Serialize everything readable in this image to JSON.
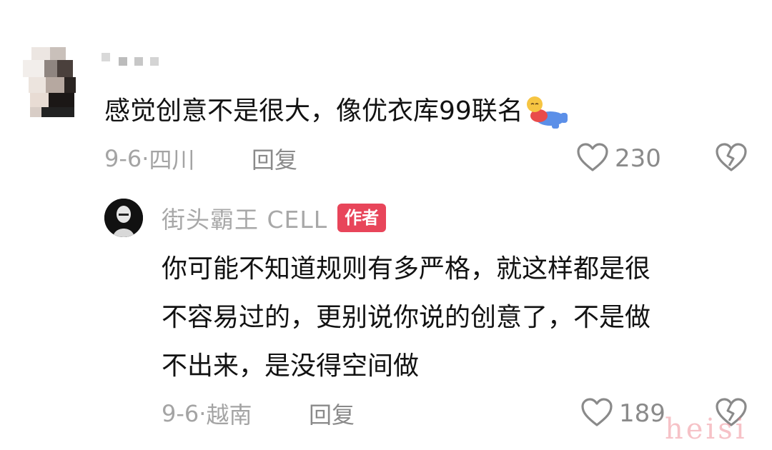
{
  "comment": {
    "avatar": "pixelated-avatar",
    "username": "pixelated-username",
    "text": "感觉创意不是很大，像优衣库99联名",
    "sticker": "sleeping-kid-emoji",
    "date": "9-6",
    "separator": "·",
    "location": "四川",
    "reply_label": "回复",
    "likes": "230",
    "like_icon": "heart-outline-icon",
    "dislike_icon": "broken-heart-icon"
  },
  "reply": {
    "avatar": "black-avatar",
    "username": "街头霸王 CELL",
    "badge": "作者",
    "badge_color": "#e8455a",
    "text_lines": [
      "你可能不知道规则有多严格，就这样都是很",
      "不容易过的，更别说你说的创意了，不是做",
      "不出来，是没得空间做"
    ],
    "date": "9-6",
    "separator": "·",
    "location": "越南",
    "reply_label": "回复",
    "likes": "189",
    "like_icon": "heart-outline-icon",
    "dislike_icon": "broken-heart-icon"
  },
  "watermark": "heisi"
}
